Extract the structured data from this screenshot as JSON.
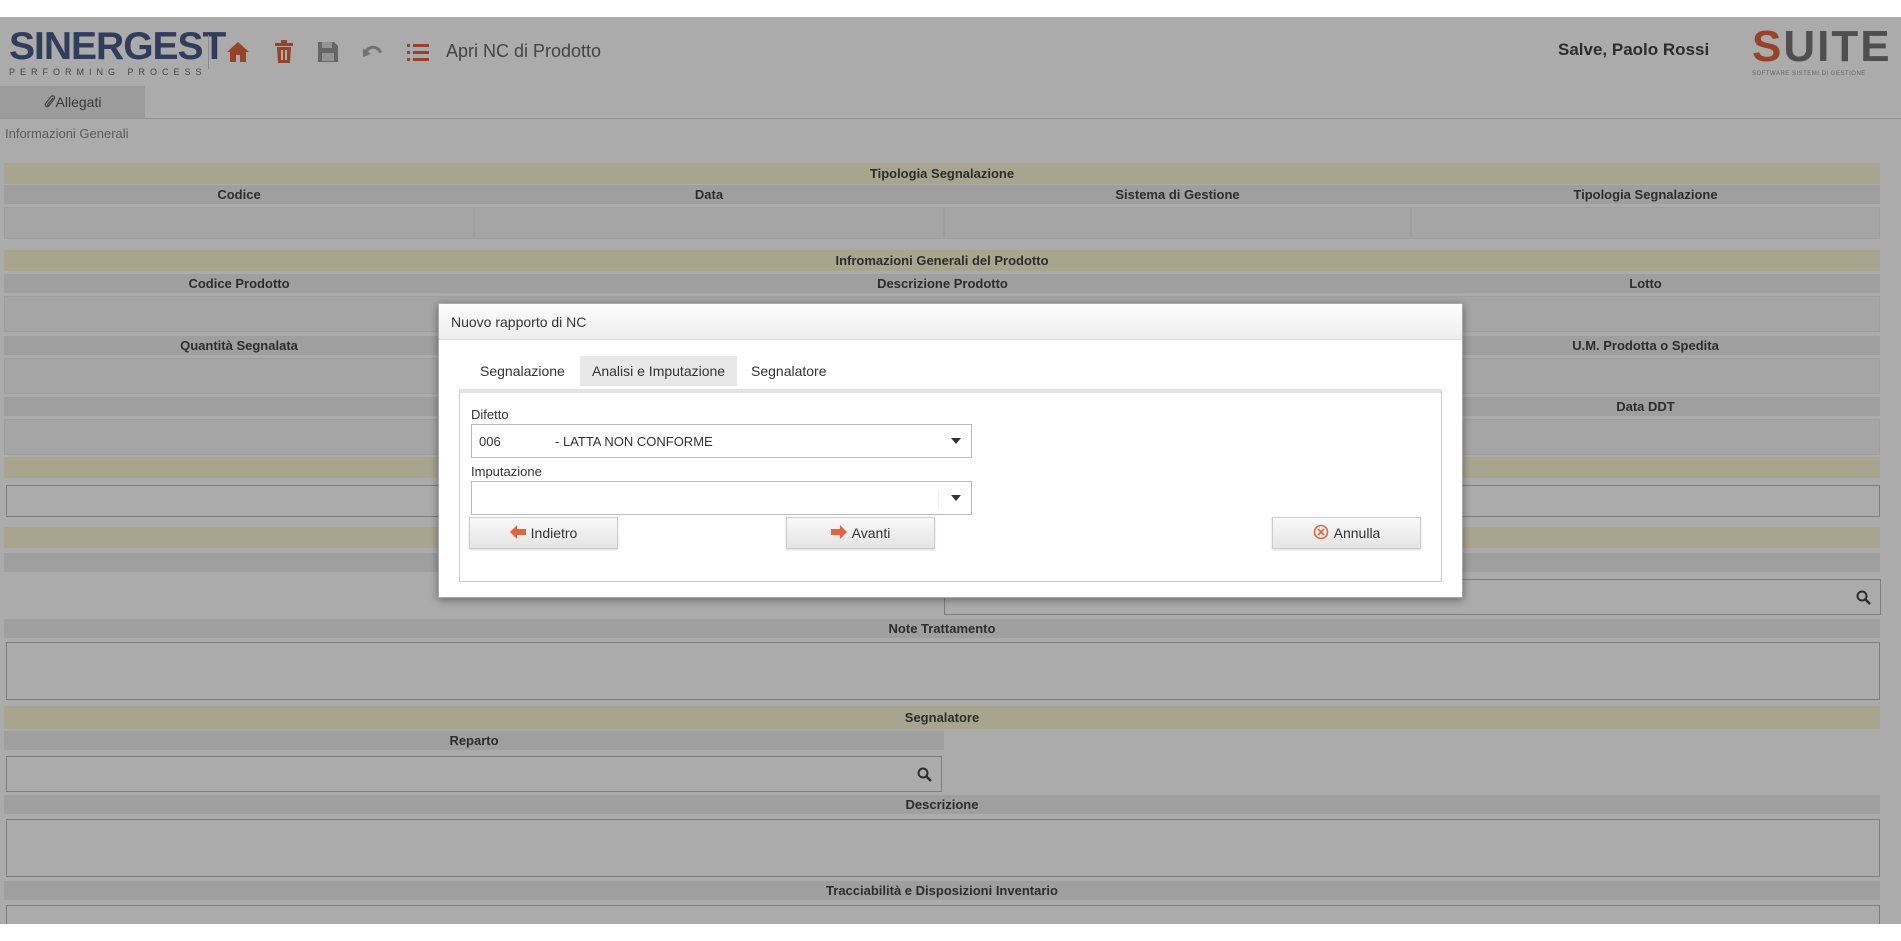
{
  "header": {
    "logo_text": "SINERGEST",
    "logo_tagline": "PERFORMING PROCESS",
    "page_title": "Apri NC di Prodotto",
    "greeting": "Salve, Paolo Rossi",
    "brand_logo": "SUITE",
    "brand_tagline": "SOFTWARE SISTEMI DI GESTIONE",
    "icons": [
      "home-icon",
      "trash-icon",
      "save-icon",
      "undo-icon",
      "list-icon"
    ],
    "accent_color": "#e1653b"
  },
  "tabs": {
    "allegati": "Allegati"
  },
  "section": {
    "general_info": "Informazioni Generali"
  },
  "form": {
    "tipologia_band": "Tipologia Segnalazione",
    "tipologia_columns": [
      "Codice",
      "Data",
      "Sistema di Gestione",
      "Tipologia Segnalazione"
    ],
    "product_band": "Infromazioni Generali del Prodotto",
    "product_columns": [
      "Codice Prodotto",
      "Descrizione Prodotto",
      "Lotto"
    ],
    "quantity_label": "Quantità Segnalata",
    "um_label": "U.M. Prodotta o Spedita",
    "ddt_label": "Data DDT",
    "note_trattamento": "Note Trattamento",
    "segnalatore_band": "Segnalatore",
    "reparto_label": "Reparto",
    "descrizione_label": "Descrizione",
    "tracciabilita_label": "Tracciabilità e Disposizioni Inventario"
  },
  "dialog": {
    "title": "Nuovo rapporto di NC",
    "tabs": [
      "Segnalazione",
      "Analisi e Imputazione",
      "Segnalatore"
    ],
    "active_tab": "Analisi e Imputazione",
    "difetto_label": "Difetto",
    "difetto_code": "006",
    "difetto_desc": "- LATTA NON CONFORME",
    "imputazione_label": "Imputazione",
    "imputazione_value": "",
    "back_label": "Indietro",
    "next_label": "Avanti",
    "cancel_label": "Annulla"
  }
}
